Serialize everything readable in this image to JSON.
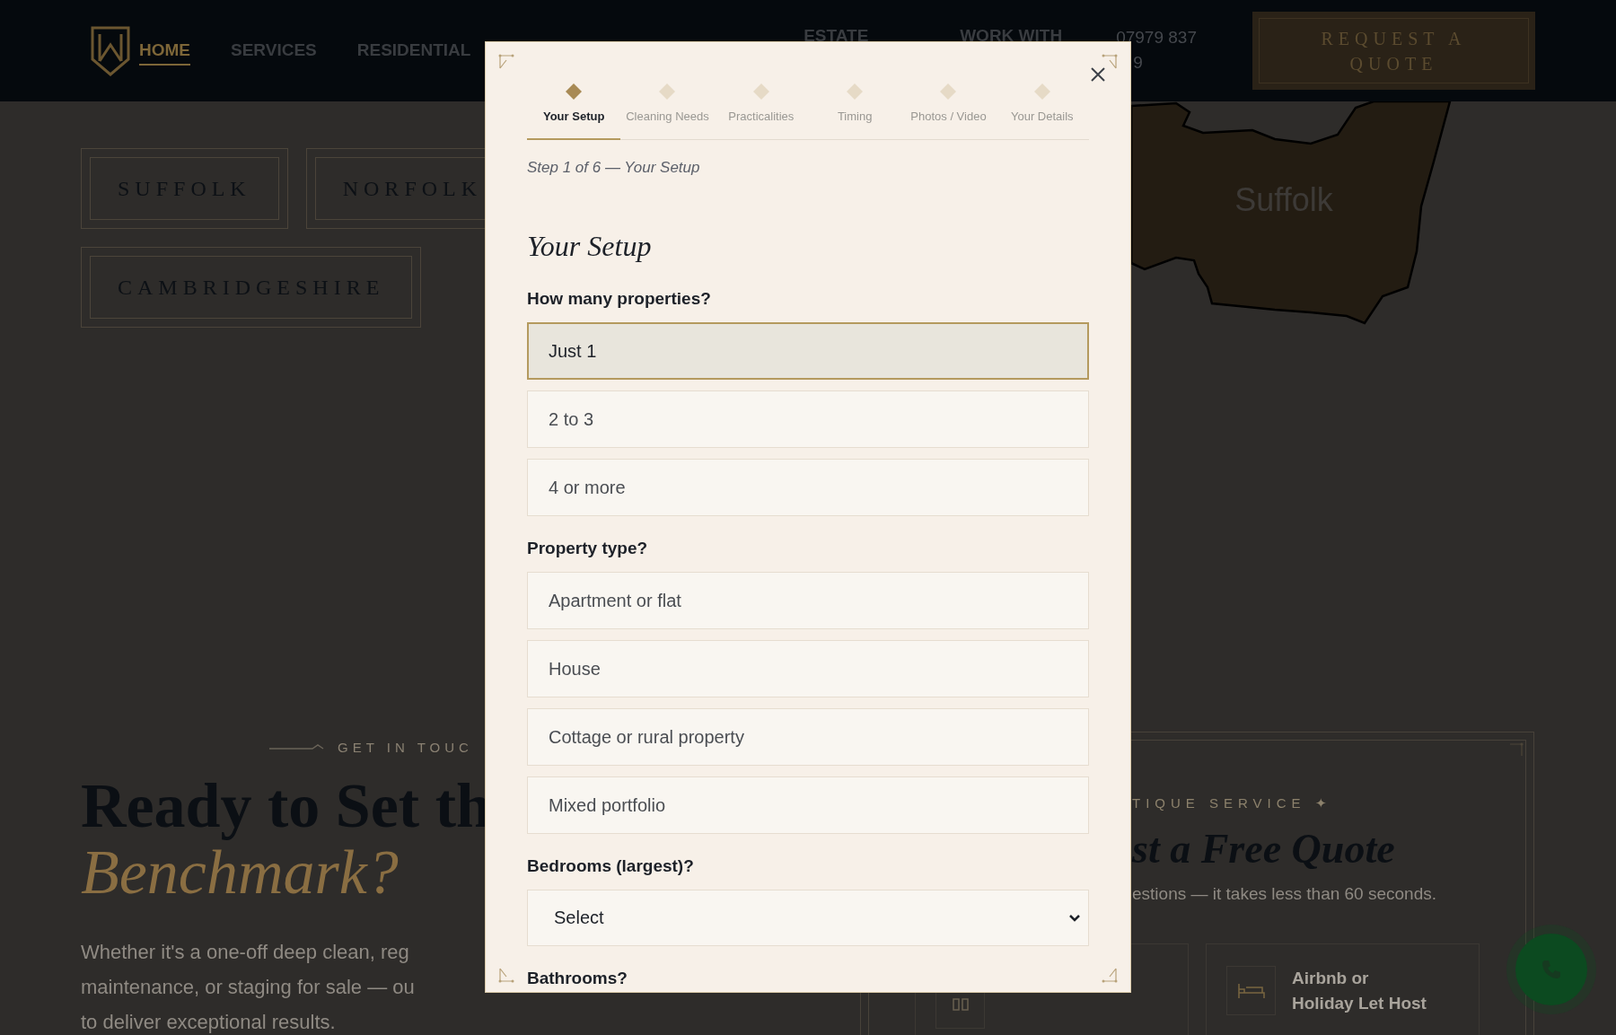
{
  "header": {
    "nav_left": [
      {
        "label": "HOME",
        "selected": true
      },
      {
        "label": "SERVICES",
        "selected": false
      },
      {
        "label": "RESIDENTIAL",
        "selected": false
      }
    ],
    "nav_right": [
      {
        "label": "ESTATE",
        "selected": false
      },
      {
        "label": "WORK WITH",
        "selected": false
      }
    ],
    "phone_lines": [
      "07979 837",
      "9"
    ],
    "cta": "REQUEST A QUOTE"
  },
  "regions": [
    {
      "label": "SUFFOLK"
    },
    {
      "label": "NORFOLK"
    },
    {
      "label": "CAMBRIDGESHIRE"
    }
  ],
  "map": {
    "label": "Suffolk"
  },
  "contact": {
    "eyebrow": "GET IN TOUC",
    "title": "Ready to Set th",
    "title_accent": "Benchmark?",
    "body_lines": [
      "Whether it's a one-off deep clean, reg",
      "maintenance, or staging for sale — ou",
      "to deliver exceptional results."
    ]
  },
  "quote_card": {
    "eyebrow": "TIQUE SERVICE ✦",
    "title": "st a Free Quote",
    "subtitle": "estions — it takes less than 60 seconds.",
    "option_cards": [
      {
        "icon_only": true
      },
      {
        "icon_only": false,
        "label_lines": [
          "Airbnb or",
          "Holiday Let Host"
        ]
      }
    ]
  },
  "modal": {
    "steps": [
      {
        "label": "Your Setup",
        "selected": true
      },
      {
        "label": "Cleaning Needs",
        "selected": false
      },
      {
        "label": "Practicalities",
        "selected": false
      },
      {
        "label": "Timing",
        "selected": false
      },
      {
        "label": "Photos / Video",
        "selected": false
      },
      {
        "label": "Your Details",
        "selected": false
      }
    ],
    "caption": "Step 1 of 6 — Your Setup",
    "title": "Your Setup",
    "questions": [
      {
        "kind": "choice",
        "label": "How many properties?",
        "options": [
          {
            "label": "Just 1",
            "selected": true
          },
          {
            "label": "2 to 3",
            "selected": false
          },
          {
            "label": "4 or more",
            "selected": false
          }
        ]
      },
      {
        "kind": "choice",
        "label": "Property type?",
        "options": [
          {
            "label": "Apartment or flat",
            "selected": false
          },
          {
            "label": "House",
            "selected": false
          },
          {
            "label": "Cottage or rural property",
            "selected": false
          },
          {
            "label": "Mixed portfolio",
            "selected": false
          }
        ]
      },
      {
        "kind": "select",
        "label": "Bedrooms (largest)?",
        "value": "Select"
      },
      {
        "kind": "select",
        "label": "Bathrooms?"
      }
    ]
  }
}
